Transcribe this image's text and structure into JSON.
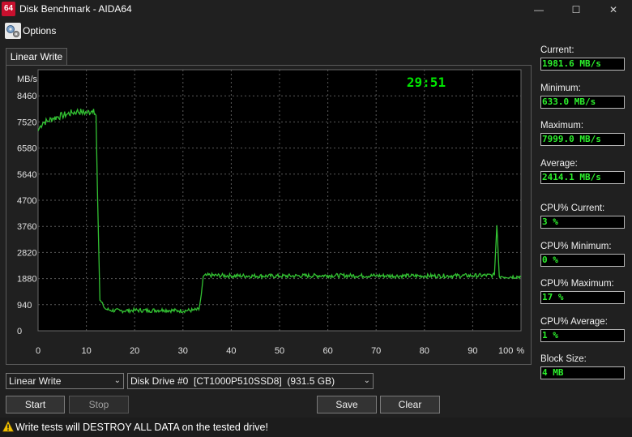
{
  "window": {
    "logo_text": "64",
    "title": "Disk Benchmark - AIDA64",
    "controls": {
      "minimize": "—",
      "maximize": "☐",
      "close": "✕"
    }
  },
  "menu": {
    "options_label": "Options",
    "options_icon": "gears-icon"
  },
  "tabs": [
    {
      "label": "Linear Write"
    }
  ],
  "chart_data": {
    "type": "line",
    "title": "",
    "timer": "29:51",
    "ylabel": "MB/s",
    "xlabel": "",
    "x_unit": "%",
    "y_ticks": [
      0,
      940,
      1880,
      2820,
      3760,
      4700,
      5640,
      6580,
      7520,
      8460
    ],
    "x_ticks": [
      0,
      10,
      20,
      30,
      40,
      50,
      60,
      70,
      80,
      90,
      100
    ],
    "xlim": [
      0,
      100
    ],
    "ylim": [
      0,
      9400
    ],
    "grid": true,
    "line_color": "#33c233",
    "timer_color": "#00e600",
    "series": [
      {
        "x": [
          0,
          0.5,
          1,
          2,
          3,
          4,
          5,
          6,
          7,
          8,
          9,
          10,
          11,
          11.5,
          12,
          12.3,
          12.8,
          13.5,
          14,
          15,
          17,
          20,
          23,
          26,
          29,
          32,
          33.3,
          33.8,
          34.2,
          35,
          40,
          50,
          60,
          70,
          80,
          90,
          94.5,
          95,
          95.5,
          96,
          100
        ],
        "y": [
          7200,
          7380,
          7500,
          7550,
          7650,
          7700,
          7750,
          7800,
          7850,
          7900,
          7880,
          7850,
          7900,
          7990,
          7750,
          5000,
          1100,
          900,
          780,
          740,
          720,
          740,
          730,
          750,
          720,
          740,
          760,
          1300,
          1950,
          2000,
          1980,
          1970,
          1990,
          1980,
          1975,
          1985,
          2000,
          3800,
          1960,
          1950,
          1950
        ]
      }
    ]
  },
  "stats": [
    {
      "label": "Current:",
      "value": "1981.6 MB/s"
    },
    {
      "label": "Minimum:",
      "value": "633.0 MB/s"
    },
    {
      "label": "Maximum:",
      "value": "7999.0 MB/s"
    },
    {
      "label": "Average:",
      "value": "2414.1 MB/s"
    },
    {
      "label": "CPU% Current:",
      "value": "3 %"
    },
    {
      "label": "CPU% Minimum:",
      "value": "0 %"
    },
    {
      "label": "CPU% Maximum:",
      "value": "17 %"
    },
    {
      "label": "CPU% Average:",
      "value": "1 %"
    },
    {
      "label": "Block Size:",
      "value": "4 MB"
    }
  ],
  "controls": {
    "test_select": "Linear Write",
    "drive_select": "Disk Drive #0  [CT1000P510SSD8]  (931.5 GB)",
    "start": "Start",
    "stop": "Stop",
    "save": "Save",
    "clear": "Clear"
  },
  "warning": {
    "text": "Write tests will DESTROY ALL DATA on the tested drive!",
    "icon": "warning-icon"
  },
  "colors": {
    "accent_green": "#2cf02c",
    "background": "#202020",
    "logo_red": "#c8102e"
  }
}
